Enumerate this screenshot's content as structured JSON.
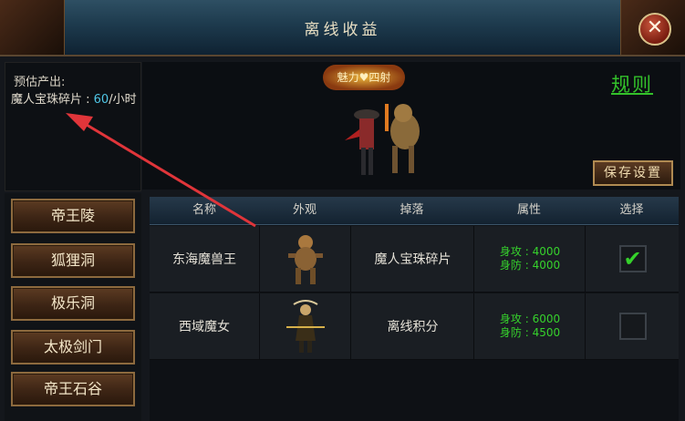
{
  "window": {
    "title": "离线收益",
    "close_symbol": "✕"
  },
  "estimate": {
    "label": "预估产出:",
    "item_name": "魔人宝珠碎片 : ",
    "rate_value": "60",
    "rate_unit": "/小时"
  },
  "preview": {
    "badge_text": "魅力♥四射",
    "rules_label": "规则",
    "save_label": "保存设置"
  },
  "maps": [
    {
      "label": "帝王陵"
    },
    {
      "label": "狐狸洞"
    },
    {
      "label": "极乐洞"
    },
    {
      "label": "太极剑门"
    },
    {
      "label": "帝王石谷"
    }
  ],
  "table": {
    "headers": [
      "名称",
      "外观",
      "掉落",
      "属性",
      "选择"
    ],
    "rows": [
      {
        "name": "东海魔兽王",
        "drop": "魔人宝珠碎片",
        "attack": "身攻 : 4000",
        "defense": "身防 : 4000",
        "selected": true
      },
      {
        "name": "西域魔女",
        "drop": "离线积分",
        "attack": "身攻 : 6000",
        "defense": "身防 : 4500",
        "selected": false
      }
    ]
  },
  "colors": {
    "accent_green": "#36d22c",
    "value_cyan": "#4fc6e6",
    "arrow_red": "#e0353a"
  }
}
